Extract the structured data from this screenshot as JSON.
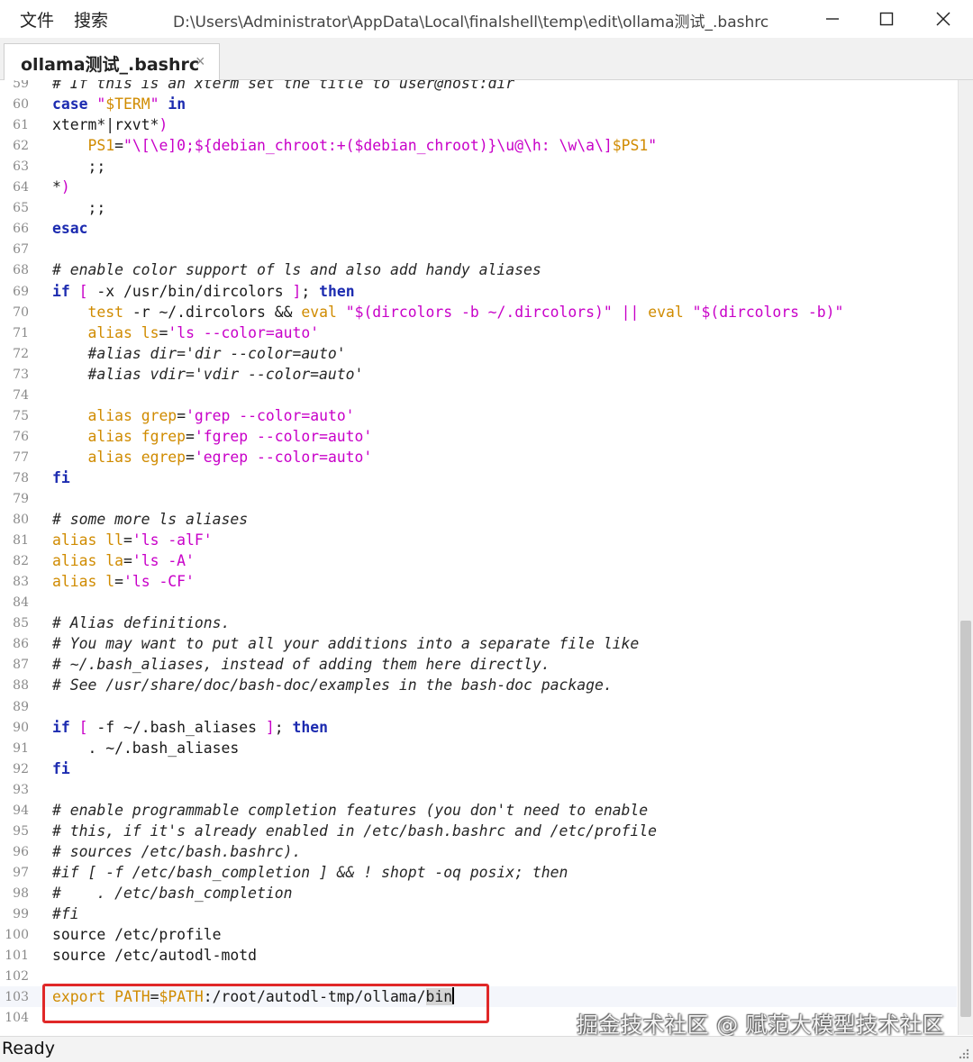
{
  "menu": {
    "file": "文件",
    "search": "搜索"
  },
  "window": {
    "path": "D:\\Users\\Administrator\\AppData\\Local\\finalshell\\temp\\edit\\ollama测试_.bashrc"
  },
  "tab": {
    "label": "ollama测试_.bashrc",
    "close": "×"
  },
  "status": {
    "text": "Ready"
  },
  "watermark": "掘金技术社区 @ 赋范大模型技术社区",
  "colors": {
    "keyword": "#1c2bb0",
    "string": "#c800c8",
    "variable": "#d08b00",
    "highlight_border": "#e02828"
  },
  "editor": {
    "lines": [
      {
        "n": "59",
        "tokens": [
          [
            "cmt",
            "# If this is an xterm set the title to user@host:dir"
          ]
        ]
      },
      {
        "n": "60",
        "tokens": [
          [
            "kw",
            "case"
          ],
          [
            "",
            " "
          ],
          [
            "str",
            "\""
          ],
          [
            "var",
            "$TERM"
          ],
          [
            "str",
            "\""
          ],
          [
            "",
            " "
          ],
          [
            "kw",
            "in"
          ]
        ]
      },
      {
        "n": "61",
        "tokens": [
          [
            "",
            "xterm*|rxvt*"
          ],
          [
            "red",
            ")"
          ]
        ]
      },
      {
        "n": "62",
        "tokens": [
          [
            "",
            "    "
          ],
          [
            "var",
            "PS1"
          ],
          [
            "",
            "="
          ],
          [
            "str",
            "\"\\[\\e]0;${debian_chroot:+($debian_chroot)}\\u@\\h: \\w\\a\\]"
          ],
          [
            "var",
            "$PS1"
          ],
          [
            "str",
            "\""
          ]
        ]
      },
      {
        "n": "63",
        "tokens": [
          [
            "",
            "    ;;"
          ]
        ]
      },
      {
        "n": "64",
        "tokens": [
          [
            "",
            "*"
          ],
          [
            "red",
            ")"
          ]
        ]
      },
      {
        "n": "65",
        "tokens": [
          [
            "",
            "    ;;"
          ]
        ]
      },
      {
        "n": "66",
        "tokens": [
          [
            "kw",
            "esac"
          ]
        ]
      },
      {
        "n": "67",
        "tokens": []
      },
      {
        "n": "68",
        "tokens": [
          [
            "cmt",
            "# enable color support of ls and also add handy aliases"
          ]
        ]
      },
      {
        "n": "69",
        "tokens": [
          [
            "kw",
            "if"
          ],
          [
            "",
            " "
          ],
          [
            "red",
            "["
          ],
          [
            "",
            " -x /usr/bin/dircolors "
          ],
          [
            "red",
            "]"
          ],
          [
            "",
            "; "
          ],
          [
            "kw",
            "then"
          ]
        ]
      },
      {
        "n": "70",
        "tokens": [
          [
            "",
            "    "
          ],
          [
            "var",
            "test"
          ],
          [
            "",
            " -r ~/.dircolors && "
          ],
          [
            "var",
            "eval"
          ],
          [
            "",
            " "
          ],
          [
            "str",
            "\"$(dircolors -b ~/.dircolors)\""
          ],
          [
            "",
            " "
          ],
          [
            "red",
            "||"
          ],
          [
            "",
            " "
          ],
          [
            "var",
            "eval"
          ],
          [
            "",
            " "
          ],
          [
            "str",
            "\"$(dircolors -b)\""
          ]
        ]
      },
      {
        "n": "71",
        "tokens": [
          [
            "",
            "    "
          ],
          [
            "var",
            "alias"
          ],
          [
            "",
            " "
          ],
          [
            "var",
            "ls"
          ],
          [
            "",
            "="
          ],
          [
            "str",
            "'ls --color=auto'"
          ]
        ]
      },
      {
        "n": "72",
        "tokens": [
          [
            "",
            "    "
          ],
          [
            "cmt",
            "#alias dir='dir --color=auto'"
          ]
        ]
      },
      {
        "n": "73",
        "tokens": [
          [
            "",
            "    "
          ],
          [
            "cmt",
            "#alias vdir='vdir --color=auto'"
          ]
        ]
      },
      {
        "n": "74",
        "tokens": []
      },
      {
        "n": "75",
        "tokens": [
          [
            "",
            "    "
          ],
          [
            "var",
            "alias"
          ],
          [
            "",
            " "
          ],
          [
            "var",
            "grep"
          ],
          [
            "",
            "="
          ],
          [
            "str",
            "'grep --color=auto'"
          ]
        ]
      },
      {
        "n": "76",
        "tokens": [
          [
            "",
            "    "
          ],
          [
            "var",
            "alias"
          ],
          [
            "",
            " "
          ],
          [
            "var",
            "fgrep"
          ],
          [
            "",
            "="
          ],
          [
            "str",
            "'fgrep --color=auto'"
          ]
        ]
      },
      {
        "n": "77",
        "tokens": [
          [
            "",
            "    "
          ],
          [
            "var",
            "alias"
          ],
          [
            "",
            " "
          ],
          [
            "var",
            "egrep"
          ],
          [
            "",
            "="
          ],
          [
            "str",
            "'egrep --color=auto'"
          ]
        ]
      },
      {
        "n": "78",
        "tokens": [
          [
            "kw",
            "fi"
          ]
        ]
      },
      {
        "n": "79",
        "tokens": []
      },
      {
        "n": "80",
        "tokens": [
          [
            "cmt",
            "# some more ls aliases"
          ]
        ]
      },
      {
        "n": "81",
        "tokens": [
          [
            "var",
            "alias"
          ],
          [
            "",
            " "
          ],
          [
            "var",
            "ll"
          ],
          [
            "",
            "="
          ],
          [
            "str",
            "'ls -alF'"
          ]
        ]
      },
      {
        "n": "82",
        "tokens": [
          [
            "var",
            "alias"
          ],
          [
            "",
            " "
          ],
          [
            "var",
            "la"
          ],
          [
            "",
            "="
          ],
          [
            "str",
            "'ls -A'"
          ]
        ]
      },
      {
        "n": "83",
        "tokens": [
          [
            "var",
            "alias"
          ],
          [
            "",
            " "
          ],
          [
            "var",
            "l"
          ],
          [
            "",
            "="
          ],
          [
            "str",
            "'ls -CF'"
          ]
        ]
      },
      {
        "n": "84",
        "tokens": []
      },
      {
        "n": "85",
        "tokens": [
          [
            "cmt",
            "# Alias definitions."
          ]
        ]
      },
      {
        "n": "86",
        "tokens": [
          [
            "cmt",
            "# You may want to put all your additions into a separate file like"
          ]
        ]
      },
      {
        "n": "87",
        "tokens": [
          [
            "cmt",
            "# ~/.bash_aliases, instead of adding them here directly."
          ]
        ]
      },
      {
        "n": "88",
        "tokens": [
          [
            "cmt",
            "# See /usr/share/doc/bash-doc/examples in the bash-doc package."
          ]
        ]
      },
      {
        "n": "89",
        "tokens": []
      },
      {
        "n": "90",
        "tokens": [
          [
            "kw",
            "if"
          ],
          [
            "",
            " "
          ],
          [
            "red",
            "["
          ],
          [
            "",
            " -f ~/.bash_aliases "
          ],
          [
            "red",
            "]"
          ],
          [
            "",
            "; "
          ],
          [
            "kw",
            "then"
          ]
        ]
      },
      {
        "n": "91",
        "tokens": [
          [
            "",
            "    . ~/.bash_aliases"
          ]
        ]
      },
      {
        "n": "92",
        "tokens": [
          [
            "kw",
            "fi"
          ]
        ]
      },
      {
        "n": "93",
        "tokens": []
      },
      {
        "n": "94",
        "tokens": [
          [
            "cmt",
            "# enable programmable completion features (you don't need to enable"
          ]
        ]
      },
      {
        "n": "95",
        "tokens": [
          [
            "cmt",
            "# this, if it's already enabled in /etc/bash.bashrc and /etc/profile"
          ]
        ]
      },
      {
        "n": "96",
        "tokens": [
          [
            "cmt",
            "# sources /etc/bash.bashrc)."
          ]
        ]
      },
      {
        "n": "97",
        "tokens": [
          [
            "cmt",
            "#if [ -f /etc/bash_completion ] && ! shopt -oq posix; then"
          ]
        ]
      },
      {
        "n": "98",
        "tokens": [
          [
            "cmt",
            "#    . /etc/bash_completion"
          ]
        ]
      },
      {
        "n": "99",
        "tokens": [
          [
            "cmt",
            "#fi"
          ]
        ]
      },
      {
        "n": "100",
        "tokens": [
          [
            "",
            "source /etc/profile"
          ]
        ]
      },
      {
        "n": "101",
        "tokens": [
          [
            "",
            "source /etc/autodl-motd"
          ]
        ]
      },
      {
        "n": "102",
        "tokens": []
      },
      {
        "n": "103",
        "tokens": [
          [
            "var",
            "export"
          ],
          [
            "",
            " "
          ],
          [
            "var",
            "PATH"
          ],
          [
            "",
            "="
          ],
          [
            "var",
            "$PATH"
          ],
          [
            "",
            ":/root/autodl-tmp/ollama/"
          ],
          [
            "sel",
            "bin"
          ]
        ],
        "current": true,
        "caret": true
      },
      {
        "n": "104",
        "tokens": []
      }
    ]
  }
}
